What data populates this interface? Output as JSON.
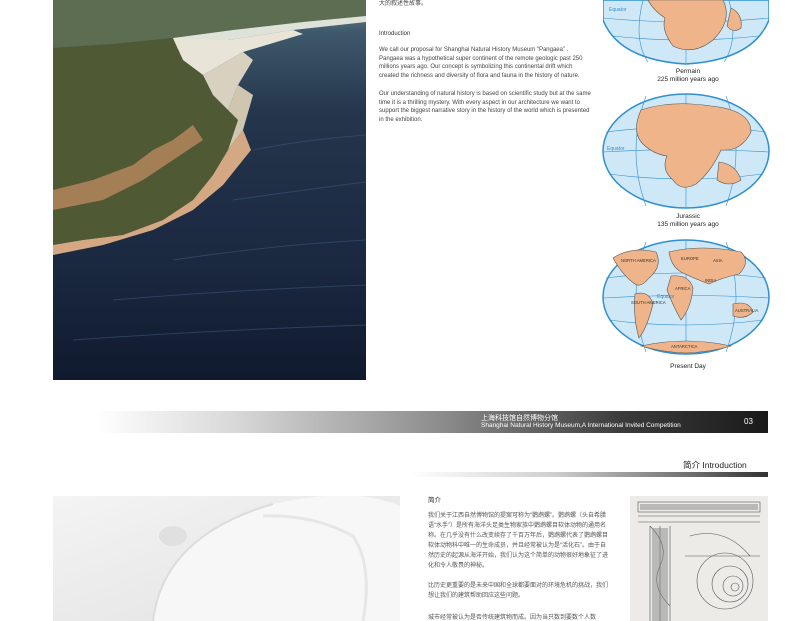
{
  "top_page": {
    "chinese_text_fragment": "大的叙述性故事。",
    "intro_heading": "Introduction",
    "intro_paragraph_1": "We call our proposal for Shanghai Natural History Museum “Pangaea” . Pangaea was a hypothetical super continent of the remote geologic past 250 millions years ago. Our concept is symbolizing this continental drift which created the richness and diversity of flora and fauna in the history of nature.",
    "intro_paragraph_2": "Our understanding of natural history is based on scientific study but at the same time it is a thrilling mystery. With every aspect in our architecture we want to support the biggest narrative story in the history of the world which is presented in the exhibition.",
    "globes": [
      {
        "label_1": "Permain",
        "label_2": "225 million years ago",
        "equator": "Equator"
      },
      {
        "label_1": "Jurassic",
        "label_2": "135 million years ago",
        "equator": "Equator"
      },
      {
        "label_1": "Present Day",
        "label_2": "",
        "equator": "Equator",
        "continents": [
          "NORTH AMERICA",
          "EUROPE",
          "ASIA",
          "AFRICA",
          "SOUTH AMERICA",
          "INDIA",
          "AUSTRALIA",
          "ANTARCTICA"
        ]
      }
    ]
  },
  "banner": {
    "title_cn": "上海科技馆自然博物分馆",
    "title_en": "Shanghai Natural History Museum,A International Invited Competition",
    "page_number": "03"
  },
  "section": {
    "heading": "简介   Introduction"
  },
  "bottom_page": {
    "cn_title": "简介",
    "cn_paragraph_1": "我们关于江西自然博物馆的提案可称为“鹦鹉螺”。鹦鹉螺（头自希腊语“水手”）是所有海洋头足类生物家族中鹦鹉螺目软体动物的通用名称。在几乎没有什么改变续存了千百万年后，鹦鹉螺代表了鹦鹉螺目软体动物科中唯一的生命成员，并且经常被认为是“活化石”。由于自然历史的起源从海洋开始，我们认为这个简单的动物很好地象征了进化和令人敬畏的神秘。",
    "cn_paragraph_2": "比历史更重要的是未来中国和全球都要面对的环境危机的挑战，我们想让我们的建筑帮助回应这些问题。",
    "cn_paragraph_3": "城市经常被认为是否传统建筑物而成。因为当只数到要数个人数"
  },
  "colors": {
    "ocean": "#2f8fd0",
    "ocean_light": "#cfe8f7",
    "land": "#f0b48a",
    "banner_dark": "#1a1a1a"
  }
}
